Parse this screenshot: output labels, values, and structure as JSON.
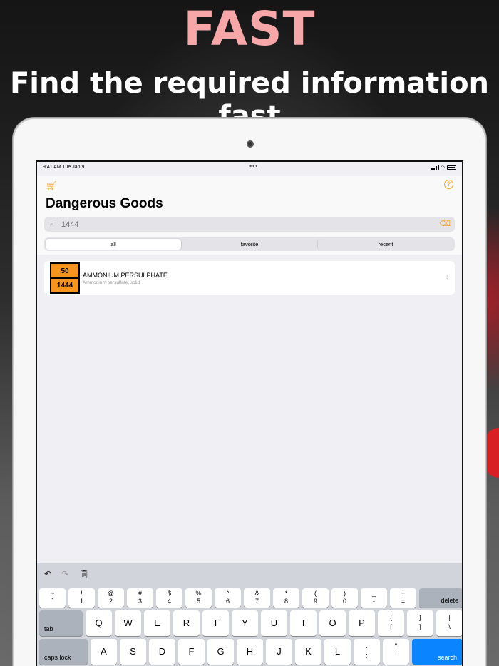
{
  "headline": {
    "big": "FAST",
    "sub": "Find the required information fast"
  },
  "status": {
    "time": "9:41 AM   Tue Jan 9",
    "dots": "•••"
  },
  "app": {
    "title": "Dangerous Goods",
    "search": {
      "value": "1444",
      "placeholder": ""
    },
    "tabs": [
      {
        "label": "all"
      },
      {
        "label": "favorite"
      },
      {
        "label": "recent"
      }
    ],
    "results": [
      {
        "hazard_id": "50",
        "un_number": "1444",
        "name": "AMMONIUM PERSULPHATE",
        "description": "Ammonium persulfate, solid"
      }
    ]
  },
  "keyboard": {
    "numrow": [
      {
        "top": "~",
        "bottom": "`"
      },
      {
        "top": "!",
        "bottom": "1"
      },
      {
        "top": "@",
        "bottom": "2"
      },
      {
        "top": "#",
        "bottom": "3"
      },
      {
        "top": "$",
        "bottom": "4"
      },
      {
        "top": "%",
        "bottom": "5"
      },
      {
        "top": "^",
        "bottom": "6"
      },
      {
        "top": "&",
        "bottom": "7"
      },
      {
        "top": "*",
        "bottom": "8"
      },
      {
        "top": "(",
        "bottom": "9"
      },
      {
        "top": ")",
        "bottom": "0"
      },
      {
        "top": "_",
        "bottom": "-"
      },
      {
        "top": "+",
        "bottom": "="
      }
    ],
    "delete": "delete",
    "tab": "tab",
    "row2": [
      "Q",
      "W",
      "E",
      "R",
      "T",
      "Y",
      "U",
      "I",
      "O",
      "P"
    ],
    "row2_extra": [
      {
        "top": "{",
        "bottom": "["
      },
      {
        "top": "}",
        "bottom": "]"
      },
      {
        "top": "|",
        "bottom": "\\"
      }
    ],
    "caps": "caps lock",
    "row3": [
      "A",
      "S",
      "D",
      "F",
      "G",
      "H",
      "J",
      "K",
      "L"
    ],
    "row3_extra": [
      {
        "top": ":",
        "bottom": ";"
      },
      {
        "top": "\"",
        "bottom": "'"
      }
    ],
    "search": "search"
  },
  "colors": {
    "accent": "#f5a623",
    "placard": "#f7941d",
    "headline": "#f7a7a7",
    "search_key": "#0a84ff"
  }
}
